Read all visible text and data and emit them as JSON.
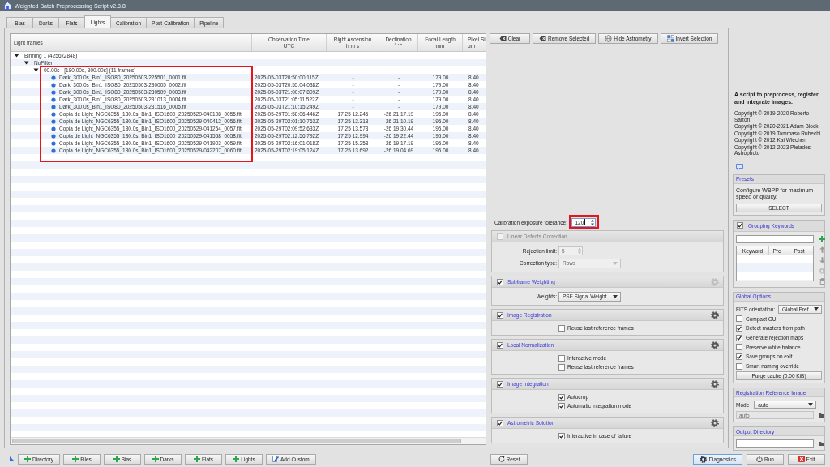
{
  "window": {
    "title": "Weighted Batch Preprocessing Script v2.8.8"
  },
  "tabs": [
    {
      "label": "Bias",
      "selected": false
    },
    {
      "label": "Darks",
      "selected": false
    },
    {
      "label": "Flats",
      "selected": false
    },
    {
      "label": "Lights",
      "selected": true
    },
    {
      "label": "Calibration",
      "selected": false
    },
    {
      "label": "Post-Calibration",
      "selected": false
    },
    {
      "label": "Pipeline",
      "selected": false
    }
  ],
  "table": {
    "columns": [
      {
        "label": "Light frames"
      },
      {
        "label": "Observation Time",
        "unit": "UTC"
      },
      {
        "label": "Right Ascension",
        "unit": "h  m  s"
      },
      {
        "label": "Declination",
        "unit": "°  '  \""
      },
      {
        "label": "Focal Length",
        "unit": "mm"
      },
      {
        "label": "Pixel Si",
        "unit": "μm"
      }
    ],
    "tree": [
      {
        "label": "Binning 1 (4256x2848)",
        "expanded": true,
        "children": [
          {
            "label": "NoFilter",
            "expanded": true,
            "children": [
              {
                "label": "00.00s - [180.00s, 300.00s] (11 frames)",
                "expanded": true,
                "highlighted": true,
                "children": [
                  {
                    "cells": [
                      "Dark_300.0s_Bin1_ISO80_20250503-225501_0001.fit",
                      "2025-05-03T20:50:00.115Z",
                      "-",
                      "-",
                      "179.00",
                      "8.40"
                    ]
                  },
                  {
                    "cells": [
                      "Dark_300.0s_Bin1_ISO80_20250503-230005_0002.fit",
                      "2025-05-03T20:55:04.038Z",
                      "-",
                      "-",
                      "179.00",
                      "8.40"
                    ]
                  },
                  {
                    "cells": [
                      "Dark_300.0s_Bin1_ISO80_20250503-230509_0003.fit",
                      "2025-05-03T21:00:07.809Z",
                      "-",
                      "-",
                      "179.00",
                      "8.40"
                    ]
                  },
                  {
                    "cells": [
                      "Dark_300.0s_Bin1_ISO80_20250503-231013_0004.fit",
                      "2025-05-03T21:05:11.522Z",
                      "-",
                      "-",
                      "179.00",
                      "8.40"
                    ]
                  },
                  {
                    "cells": [
                      "Dark_300.0s_Bin1_ISO80_20250503-231516_0005.fit",
                      "2025-05-03T21:10:15.249Z",
                      "-",
                      "-",
                      "179.00",
                      "8.40"
                    ]
                  },
                  {
                    "cells": [
                      "Copia de Light_NGC6355_180.0s_Bin1_ISO1600_20250529-040108_0055.fit",
                      "2025-05-29T01:58:06.446Z",
                      "17 25 12.245",
                      "-26 21 17.19",
                      "195.00",
                      "8.40"
                    ]
                  },
                  {
                    "cells": [
                      "Copia de Light_NGC6355_180.0s_Bin1_ISO1600_20250529-040412_0056.fit",
                      "2025-05-29T02:01:10.763Z",
                      "17 25 12.313",
                      "-26 21 10.19",
                      "195.00",
                      "8.40"
                    ]
                  },
                  {
                    "cells": [
                      "Copia de Light_NGC6355_180.0s_Bin1_ISO1600_20250529-041254_0057.fit",
                      "2025-05-29T02:09:52.633Z",
                      "17 25 13.573",
                      "-26 19 30.44",
                      "195.00",
                      "8.40"
                    ]
                  },
                  {
                    "cells": [
                      "Copia de Light_NGC6355_180.0s_Bin1_ISO1600_20250529-041558_0058.fit",
                      "2025-05-29T02:12:56.792Z",
                      "17 25 12.994",
                      "-26 19 22.44",
                      "195.00",
                      "8.40"
                    ]
                  },
                  {
                    "cells": [
                      "Copia de Light_NGC6355_180.0s_Bin1_ISO1600_20250529-041903_0059.fit",
                      "2025-05-29T02:16:01.018Z",
                      "17 25 15.258",
                      "-26 19 17.19",
                      "195.00",
                      "8.40"
                    ]
                  },
                  {
                    "cells": [
                      "Copia de Light_NGC6355_180.0s_Bin1_ISO1600_20250529-042207_0060.fit",
                      "2025-05-29T02:19:05.124Z",
                      "17 25 13.692",
                      "-26 19 04.69",
                      "195.00",
                      "8.40"
                    ]
                  }
                ]
              }
            ]
          }
        ]
      }
    ]
  },
  "toolbar": [
    {
      "label": "Clear",
      "kind": "clear"
    },
    {
      "label": "Remove Selected",
      "kind": "remove"
    },
    {
      "label": "Hide Astrometry",
      "kind": "astrometry"
    },
    {
      "label": "Invert Selection",
      "kind": "invert"
    }
  ],
  "tolerance": {
    "label": "Calibration exposure tolerance:",
    "value": "120",
    "highlighted": true,
    "focused": true
  },
  "sections": [
    {
      "title": "Linear Defects Correction",
      "checked": false,
      "disabled": true,
      "rows": [
        {
          "kind": "spin",
          "label": "Rejection limit:",
          "value": "5"
        },
        {
          "kind": "select",
          "label": "Correction type:",
          "value": "Rows"
        }
      ]
    },
    {
      "title": "Subframe Weighting",
      "checked": true,
      "disabled": false,
      "gear": {
        "disabled": true
      },
      "rows": [
        {
          "kind": "select",
          "label": "Weights:",
          "value": "PSF Signal Weight"
        }
      ]
    },
    {
      "title": "Image Registration",
      "checked": true,
      "disabled": false,
      "gear": {
        "disabled": false
      },
      "rows": [
        {
          "kind": "checkbox",
          "label": "Reuse last reference frames",
          "checked": false
        }
      ]
    },
    {
      "title": "Local Normalization",
      "checked": true,
      "disabled": false,
      "gear": {
        "disabled": false
      },
      "rows": [
        {
          "kind": "checkbox",
          "label": "Interactive mode",
          "checked": false
        },
        {
          "kind": "checkbox",
          "label": "Reuse last reference frames",
          "checked": false
        }
      ]
    },
    {
      "title": "Image Integration",
      "checked": true,
      "disabled": false,
      "gear": {
        "disabled": false
      },
      "rows": [
        {
          "kind": "checkbox",
          "label": "Autocrop",
          "checked": true
        },
        {
          "kind": "checkbox",
          "label": "Automatic integration mode",
          "checked": true
        }
      ]
    },
    {
      "title": "Astrometric Solution",
      "checked": true,
      "disabled": false,
      "gear": {
        "disabled": false
      },
      "rows": [
        {
          "kind": "checkbox",
          "label": "Interactive in case of failure",
          "checked": true
        }
      ]
    }
  ],
  "sidebar": {
    "description": "A script to preprocess, register, and integrate images.",
    "copyrights": [
      "Copyright © 2019-2020 Roberto Sartori",
      "Copyright © 2020-2021 Adam Block",
      "Copyright © 2019 Tommaso Rubechi",
      "Copyright © 2012 Kai Wiechen",
      "Copyright © 2012-2023 Pleiades Astrophoto"
    ],
    "presets": {
      "title": "Presets",
      "text": "Configure WBPP for maximum speed or quality.",
      "button": "SELECT"
    },
    "grouping": {
      "title": "Grouping Keywords",
      "checked": true,
      "columns": [
        "Keyword",
        "Pre",
        "Post"
      ]
    },
    "global_options": {
      "title": "Global Options",
      "fits_label": "FITS orientation:",
      "fits_value": "Global Pref",
      "options": [
        {
          "label": "Compact GUI",
          "checked": false
        },
        {
          "label": "Detect masters from path",
          "checked": true
        },
        {
          "label": "Generate rejection maps",
          "checked": true
        },
        {
          "label": "Preserve white balance",
          "checked": false
        },
        {
          "label": "Save groups on exit",
          "checked": true
        },
        {
          "label": "Smart naming override",
          "checked": false
        }
      ],
      "button": "Purge cache (0.00 KiB)"
    },
    "registration_reference": {
      "title": "Registration Reference Image",
      "mode_label": "Mode",
      "mode_value": "auto",
      "path": {
        "value": "auto",
        "disabled": true
      }
    },
    "output_directory": {
      "title": "Output Directory"
    }
  },
  "bottom_bar": {
    "left": [
      {
        "label": "Directory",
        "kind": "add"
      },
      {
        "label": "Files",
        "kind": "add"
      },
      {
        "label": "Bias",
        "kind": "add"
      },
      {
        "label": "Darks",
        "kind": "add"
      },
      {
        "label": "Flats",
        "kind": "add"
      },
      {
        "label": "Lights",
        "kind": "add"
      },
      {
        "label": "Add Custom",
        "kind": "custom"
      }
    ],
    "center": [
      {
        "label": "Reset",
        "kind": "reset"
      }
    ],
    "right": [
      {
        "label": "Diagnostics",
        "kind": "diagnostics",
        "focused": true
      },
      {
        "label": "Run",
        "kind": "run",
        "focused": false
      },
      {
        "label": "Exit",
        "kind": "exit",
        "focused": false
      }
    ]
  }
}
